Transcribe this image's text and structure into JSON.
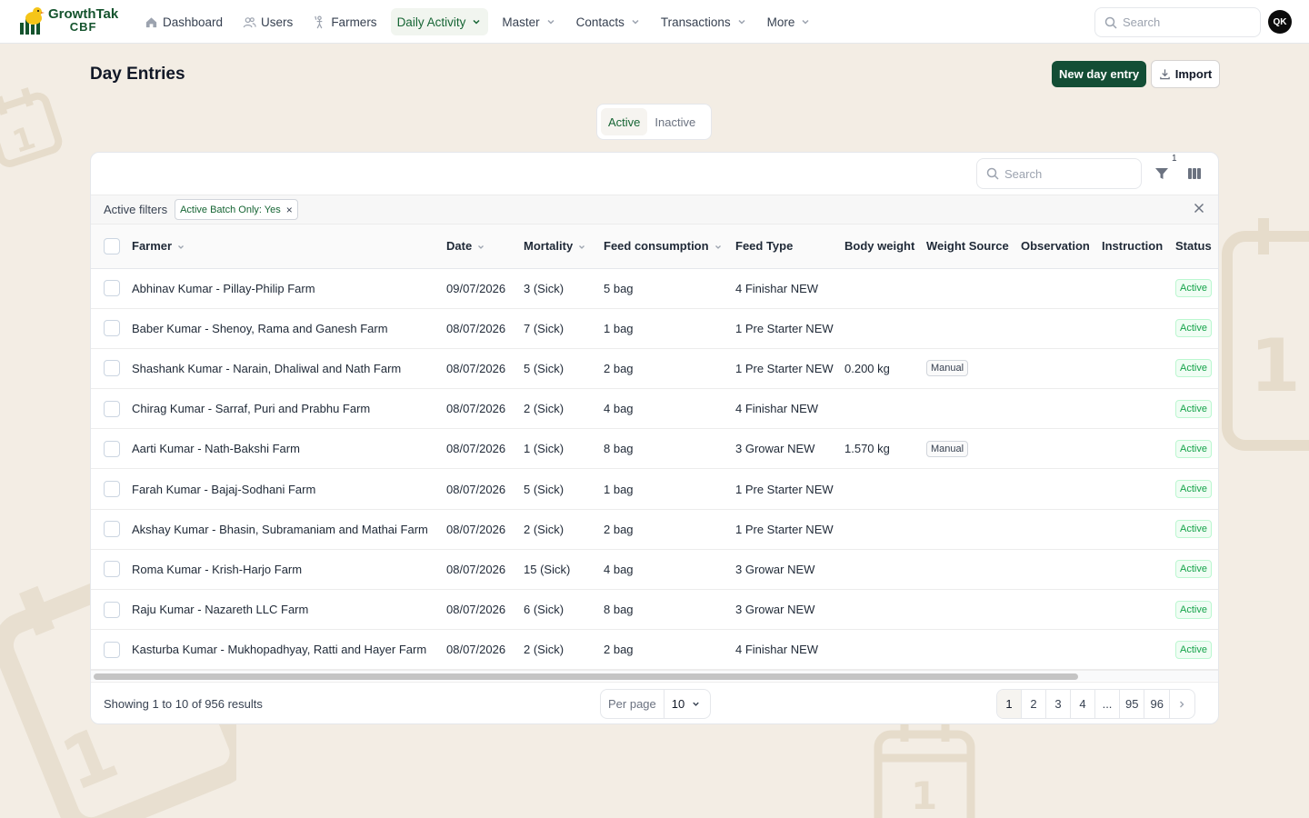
{
  "brand": {
    "name": "GrowthTak",
    "sub": "CBF"
  },
  "nav": [
    {
      "label": "Dashboard",
      "icon": "home-icon",
      "dropdown": false,
      "active": false
    },
    {
      "label": "Users",
      "icon": "users-icon",
      "dropdown": false,
      "active": false
    },
    {
      "label": "Farmers",
      "icon": "farmer-icon",
      "dropdown": false,
      "active": false
    },
    {
      "label": "Daily Activity",
      "icon": "",
      "dropdown": true,
      "active": true
    },
    {
      "label": "Master",
      "icon": "",
      "dropdown": true,
      "active": false
    },
    {
      "label": "Contacts",
      "icon": "",
      "dropdown": true,
      "active": false
    },
    {
      "label": "Transactions",
      "icon": "",
      "dropdown": true,
      "active": false
    },
    {
      "label": "More",
      "icon": "",
      "dropdown": true,
      "active": false
    }
  ],
  "top_search": {
    "placeholder": "Search"
  },
  "user": {
    "initials": "QK"
  },
  "page": {
    "title": "Day Entries",
    "new_button": "New day entry",
    "import_button": "Import"
  },
  "status_tabs": {
    "active": "Active",
    "inactive": "Inactive"
  },
  "table_toolbar": {
    "search_placeholder": "Search",
    "filter_count": "1"
  },
  "filters": {
    "label": "Active filters",
    "chip": "Active Batch Only: Yes"
  },
  "columns": [
    "Farmer",
    "Date",
    "Mortality",
    "Feed consumption",
    "Feed Type",
    "Body weight",
    "Weight Source",
    "Observation",
    "Instruction",
    "Status"
  ],
  "rows": [
    {
      "farmer": "Abhinav Kumar - Pillay-Philip Farm",
      "date": "09/07/2026",
      "mortality": "3 (Sick)",
      "feed": "5 bag",
      "feed_type": "4 Finishar NEW",
      "body_weight": "",
      "weight_source": "",
      "observation": "",
      "instruction": "",
      "status": "Active"
    },
    {
      "farmer": "Baber Kumar - Shenoy, Rama and Ganesh Farm",
      "date": "08/07/2026",
      "mortality": "7 (Sick)",
      "feed": "1 bag",
      "feed_type": "1 Pre Starter NEW",
      "body_weight": "",
      "weight_source": "",
      "observation": "",
      "instruction": "",
      "status": "Active"
    },
    {
      "farmer": "Shashank Kumar - Narain, Dhaliwal and Nath Farm",
      "date": "08/07/2026",
      "mortality": "5 (Sick)",
      "feed": "2 bag",
      "feed_type": "1 Pre Starter NEW",
      "body_weight": "0.200 kg",
      "weight_source": "Manual",
      "observation": "",
      "instruction": "",
      "status": "Active"
    },
    {
      "farmer": "Chirag Kumar - Sarraf, Puri and Prabhu Farm",
      "date": "08/07/2026",
      "mortality": "2 (Sick)",
      "feed": "4 bag",
      "feed_type": "4 Finishar NEW",
      "body_weight": "",
      "weight_source": "",
      "observation": "",
      "instruction": "",
      "status": "Active"
    },
    {
      "farmer": "Aarti Kumar - Nath-Bakshi Farm",
      "date": "08/07/2026",
      "mortality": "1 (Sick)",
      "feed": "8 bag",
      "feed_type": "3 Growar NEW",
      "body_weight": "1.570 kg",
      "weight_source": "Manual",
      "observation": "",
      "instruction": "",
      "status": "Active"
    },
    {
      "farmer": "Farah Kumar - Bajaj-Sodhani Farm",
      "date": "08/07/2026",
      "mortality": "5 (Sick)",
      "feed": "1 bag",
      "feed_type": "1 Pre Starter NEW",
      "body_weight": "",
      "weight_source": "",
      "observation": "",
      "instruction": "",
      "status": "Active"
    },
    {
      "farmer": "Akshay Kumar - Bhasin, Subramaniam and Mathai Farm",
      "date": "08/07/2026",
      "mortality": "2 (Sick)",
      "feed": "2 bag",
      "feed_type": "1 Pre Starter NEW",
      "body_weight": "",
      "weight_source": "",
      "observation": "",
      "instruction": "",
      "status": "Active"
    },
    {
      "farmer": "Roma Kumar - Krish-Harjo Farm",
      "date": "08/07/2026",
      "mortality": "15 (Sick)",
      "feed": "4 bag",
      "feed_type": "3 Growar NEW",
      "body_weight": "",
      "weight_source": "",
      "observation": "",
      "instruction": "",
      "status": "Active"
    },
    {
      "farmer": "Raju Kumar - Nazareth LLC Farm",
      "date": "08/07/2026",
      "mortality": "6 (Sick)",
      "feed": "8 bag",
      "feed_type": "3 Growar NEW",
      "body_weight": "",
      "weight_source": "",
      "observation": "",
      "instruction": "",
      "status": "Active"
    },
    {
      "farmer": "Kasturba Kumar - Mukhopadhyay, Ratti and Hayer Farm",
      "date": "08/07/2026",
      "mortality": "2 (Sick)",
      "feed": "2 bag",
      "feed_type": "4 Finishar NEW",
      "body_weight": "",
      "weight_source": "",
      "observation": "",
      "instruction": "",
      "status": "Active"
    }
  ],
  "footer": {
    "showing": "Showing 1 to 10 of 956 results",
    "per_page_label": "Per page",
    "per_page_value": "10",
    "pages": [
      "1",
      "2",
      "3",
      "4",
      "...",
      "95",
      "96"
    ]
  },
  "colors": {
    "primary": "#134e35",
    "accent": "#166534",
    "background": "#f3ede4",
    "status_active": "#16a34a"
  }
}
